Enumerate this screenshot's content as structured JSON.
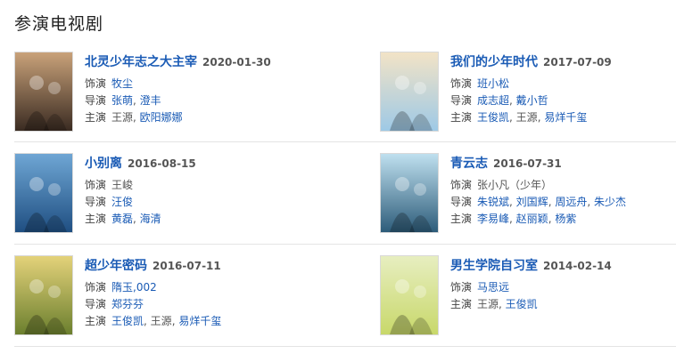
{
  "section": {
    "title": "参演电视剧"
  },
  "items": [
    {
      "title": "北灵少年志之大主宰",
      "date": "2020-01-30",
      "role_label": "饰演",
      "roles": [
        {
          "text": "牧尘",
          "link": true
        }
      ],
      "director_label": "导演",
      "directors": [
        {
          "text": "张萌",
          "link": true
        },
        {
          "text": "澄丰",
          "link": true
        }
      ],
      "cast_label": "主演",
      "cast": [
        {
          "text": "王源",
          "link": false
        },
        {
          "text": "欧阳娜娜",
          "link": true
        }
      ],
      "poster_colors": [
        "#3a2b22",
        "#c9a27a"
      ]
    },
    {
      "title": "我们的少年时代",
      "date": "2017-07-09",
      "role_label": "饰演",
      "roles": [
        {
          "text": "班小松",
          "link": true
        }
      ],
      "director_label": "导演",
      "directors": [
        {
          "text": "成志超",
          "link": true
        },
        {
          "text": "戴小哲",
          "link": true
        }
      ],
      "cast_label": "主演",
      "cast": [
        {
          "text": "王俊凯",
          "link": true
        },
        {
          "text": "王源",
          "link": false
        },
        {
          "text": "易烊千玺",
          "link": true
        }
      ],
      "poster_colors": [
        "#9ec9e6",
        "#f2e3c6"
      ]
    },
    {
      "title": "小别离",
      "date": "2016-08-15",
      "role_label": "饰演",
      "roles": [
        {
          "text": "王峻",
          "link": false
        }
      ],
      "director_label": "导演",
      "directors": [
        {
          "text": "汪俊",
          "link": true
        }
      ],
      "cast_label": "主演",
      "cast": [
        {
          "text": "黄磊",
          "link": true
        },
        {
          "text": "海清",
          "link": true
        }
      ],
      "poster_colors": [
        "#1f4f82",
        "#6fa6d4"
      ]
    },
    {
      "title": "青云志",
      "date": "2016-07-31",
      "role_label": "饰演",
      "roles": [
        {
          "text": "张小凡（少年）",
          "link": false
        }
      ],
      "director_label": "导演",
      "directors": [
        {
          "text": "朱锐斌",
          "link": true
        },
        {
          "text": "刘国辉",
          "link": true
        },
        {
          "text": "周远舟",
          "link": true
        },
        {
          "text": "朱少杰",
          "link": true
        }
      ],
      "cast_label": "主演",
      "cast": [
        {
          "text": "李易峰",
          "link": true
        },
        {
          "text": "赵丽颖",
          "link": true
        },
        {
          "text": "杨紫",
          "link": true
        }
      ],
      "poster_colors": [
        "#2d5c7a",
        "#bfe0ef"
      ]
    },
    {
      "title": "超少年密码",
      "date": "2016-07-11",
      "role_label": "饰演",
      "roles": [
        {
          "text": "隋玉,002",
          "link": true
        }
      ],
      "director_label": "导演",
      "directors": [
        {
          "text": "郑芬芬",
          "link": true
        }
      ],
      "cast_label": "主演",
      "cast": [
        {
          "text": "王俊凯",
          "link": true
        },
        {
          "text": "王源",
          "link": false
        },
        {
          "text": "易烊千玺",
          "link": true
        }
      ],
      "poster_colors": [
        "#6b7f2e",
        "#e4d27a"
      ]
    },
    {
      "title": "男生学院自习室",
      "date": "2014-02-14",
      "role_label": "饰演",
      "roles": [
        {
          "text": "马思远",
          "link": true
        }
      ],
      "director_label": "",
      "directors": [],
      "cast_label": "主演",
      "cast": [
        {
          "text": "王源",
          "link": false
        },
        {
          "text": "王俊凯",
          "link": true
        }
      ],
      "poster_colors": [
        "#c8d86a",
        "#e7eec0"
      ]
    }
  ]
}
